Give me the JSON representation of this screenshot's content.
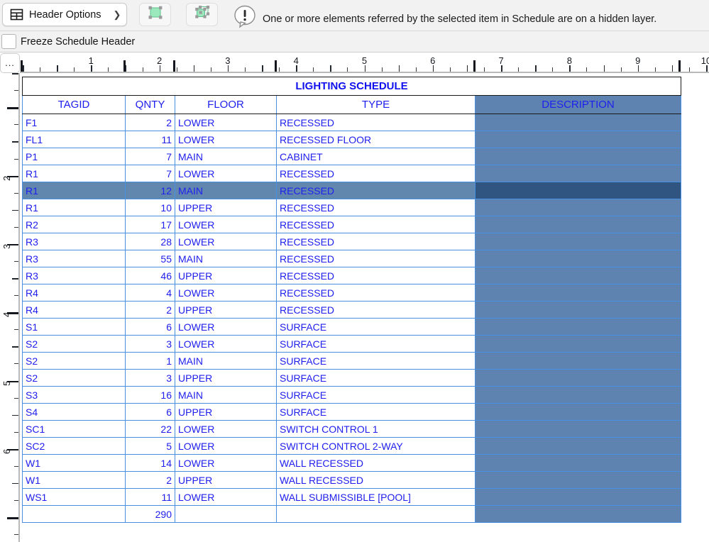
{
  "toolbar": {
    "header_options_label": "Header Options",
    "header_options_icon": "table-header-icon",
    "chevron_icon": "chevron-right-icon",
    "tool_2d_icon": "select-2d-element-icon",
    "tool_3d_icon": "select-3d-element-icon",
    "warning_icon": "exclamation-bubble-icon",
    "warning_text": "One or more elements referred by the selected item in Schedule are on a hidden layer."
  },
  "freeze": {
    "checkbox_name": "freeze-schedule-header-checkbox",
    "checked": false,
    "label": "Freeze Schedule Header"
  },
  "rulers": {
    "corner_label": "...",
    "horizontal_units": [
      "1",
      "2",
      "3",
      "4",
      "5",
      "6",
      "7",
      "8",
      "9",
      "10"
    ],
    "vertical_units": [
      "2",
      "3",
      "4",
      "5",
      "6"
    ]
  },
  "colors": {
    "text_blue": "#2020ee",
    "description_fill": "#5e83b0",
    "selected_row_fill": "#6287af",
    "selected_desc_fill": "#2f5580",
    "selected_text": "#e8ea4a",
    "grid_line": "#4a90e2",
    "border_dark": "#1a1a1a"
  },
  "schedule": {
    "title": "LIGHTING SCHEDULE",
    "columns": [
      "TAGID",
      "QNTY",
      "FLOOR",
      "TYPE",
      "DESCRIPTION"
    ],
    "rows": [
      {
        "tagid": "F1",
        "qnty": "2",
        "floor": "LOWER",
        "type": "RECESSED",
        "description": "",
        "selected": false
      },
      {
        "tagid": "FL1",
        "qnty": "11",
        "floor": "LOWER",
        "type": "RECESSED FLOOR",
        "description": "",
        "selected": false
      },
      {
        "tagid": "P1",
        "qnty": "7",
        "floor": "MAIN",
        "type": "CABINET",
        "description": "",
        "selected": false
      },
      {
        "tagid": "R1",
        "qnty": "7",
        "floor": "LOWER",
        "type": "RECESSED",
        "description": "",
        "selected": false
      },
      {
        "tagid": "R1",
        "qnty": "12",
        "floor": "MAIN",
        "type": "RECESSED",
        "description": "",
        "selected": true
      },
      {
        "tagid": "R1",
        "qnty": "10",
        "floor": "UPPER",
        "type": "RECESSED",
        "description": "",
        "selected": false
      },
      {
        "tagid": "R2",
        "qnty": "17",
        "floor": "LOWER",
        "type": "RECESSED",
        "description": "",
        "selected": false
      },
      {
        "tagid": "R3",
        "qnty": "28",
        "floor": "LOWER",
        "type": "RECESSED",
        "description": "",
        "selected": false
      },
      {
        "tagid": "R3",
        "qnty": "55",
        "floor": "MAIN",
        "type": "RECESSED",
        "description": "",
        "selected": false
      },
      {
        "tagid": "R3",
        "qnty": "46",
        "floor": "UPPER",
        "type": "RECESSED",
        "description": "",
        "selected": false
      },
      {
        "tagid": "R4",
        "qnty": "4",
        "floor": "LOWER",
        "type": "RECESSED",
        "description": "",
        "selected": false
      },
      {
        "tagid": "R4",
        "qnty": "2",
        "floor": "UPPER",
        "type": "RECESSED",
        "description": "",
        "selected": false
      },
      {
        "tagid": "S1",
        "qnty": "6",
        "floor": "LOWER",
        "type": "SURFACE",
        "description": "",
        "selected": false
      },
      {
        "tagid": "S2",
        "qnty": "3",
        "floor": "LOWER",
        "type": "SURFACE",
        "description": "",
        "selected": false
      },
      {
        "tagid": "S2",
        "qnty": "1",
        "floor": "MAIN",
        "type": "SURFACE",
        "description": "",
        "selected": false
      },
      {
        "tagid": "S2",
        "qnty": "3",
        "floor": "UPPER",
        "type": "SURFACE",
        "description": "",
        "selected": false
      },
      {
        "tagid": "S3",
        "qnty": "16",
        "floor": "MAIN",
        "type": "SURFACE",
        "description": "",
        "selected": false
      },
      {
        "tagid": "S4",
        "qnty": "6",
        "floor": "UPPER",
        "type": "SURFACE",
        "description": "",
        "selected": false
      },
      {
        "tagid": "SC1",
        "qnty": "22",
        "floor": "LOWER",
        "type": "SWITCH CONTROL 1",
        "description": "",
        "selected": false
      },
      {
        "tagid": "SC2",
        "qnty": "5",
        "floor": "LOWER",
        "type": "SWITCH CONTROL 2-WAY",
        "description": "",
        "selected": false
      },
      {
        "tagid": "W1",
        "qnty": "14",
        "floor": "LOWER",
        "type": "WALL RECESSED",
        "description": "",
        "selected": false
      },
      {
        "tagid": "W1",
        "qnty": "2",
        "floor": "UPPER",
        "type": "WALL RECESSED",
        "description": "",
        "selected": false
      },
      {
        "tagid": "WS1",
        "qnty": "11",
        "floor": "LOWER",
        "type": "WALL SUBMISSIBLE [POOL]",
        "description": "",
        "selected": false
      }
    ],
    "total_row": {
      "tagid": "",
      "qnty": "290",
      "floor": "",
      "type": "",
      "description": ""
    }
  }
}
